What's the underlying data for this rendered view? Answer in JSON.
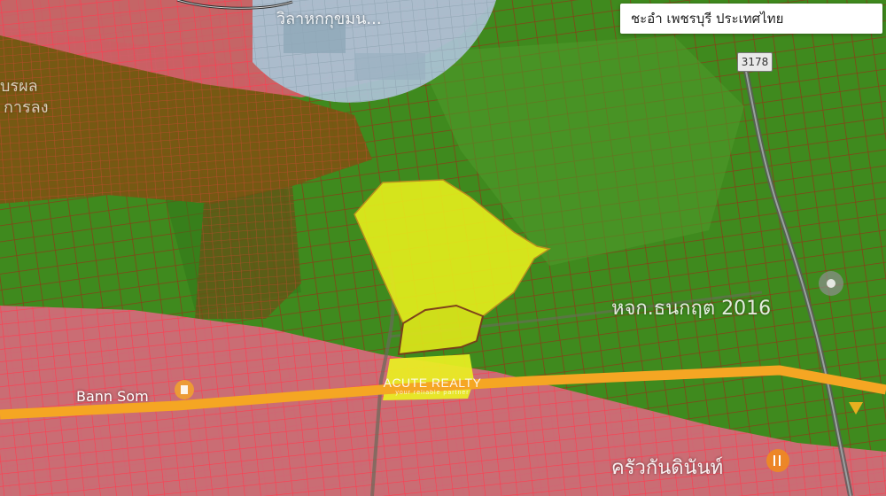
{
  "search": {
    "location": "ชะอำ เพชรบุรี ประเทศไทย"
  },
  "road_shield": {
    "number": "3178"
  },
  "labels": {
    "top_center": "วิลาหกกุขมน...",
    "left_top": "บรผล",
    "left_top2": "การลง",
    "bann_som": "Bann Som",
    "right_mid": "หจก.ธนกฤต 2016",
    "bottom_right": "ครัวกันดินันท์"
  },
  "watermark": {
    "title": "ACUTE REALTY",
    "subtitle": "your reliable partner"
  },
  "colors": {
    "green_zone": "#3f8a1e",
    "brown_zone": "#7a5a14",
    "red_zone": "#d9667a",
    "blue_zone": "#a9bfd0",
    "highlight": "#e6f01a",
    "road": "#f5a623",
    "parcel_lines_green": "#8a3a1a",
    "parcel_lines_red": "#e8384a"
  }
}
